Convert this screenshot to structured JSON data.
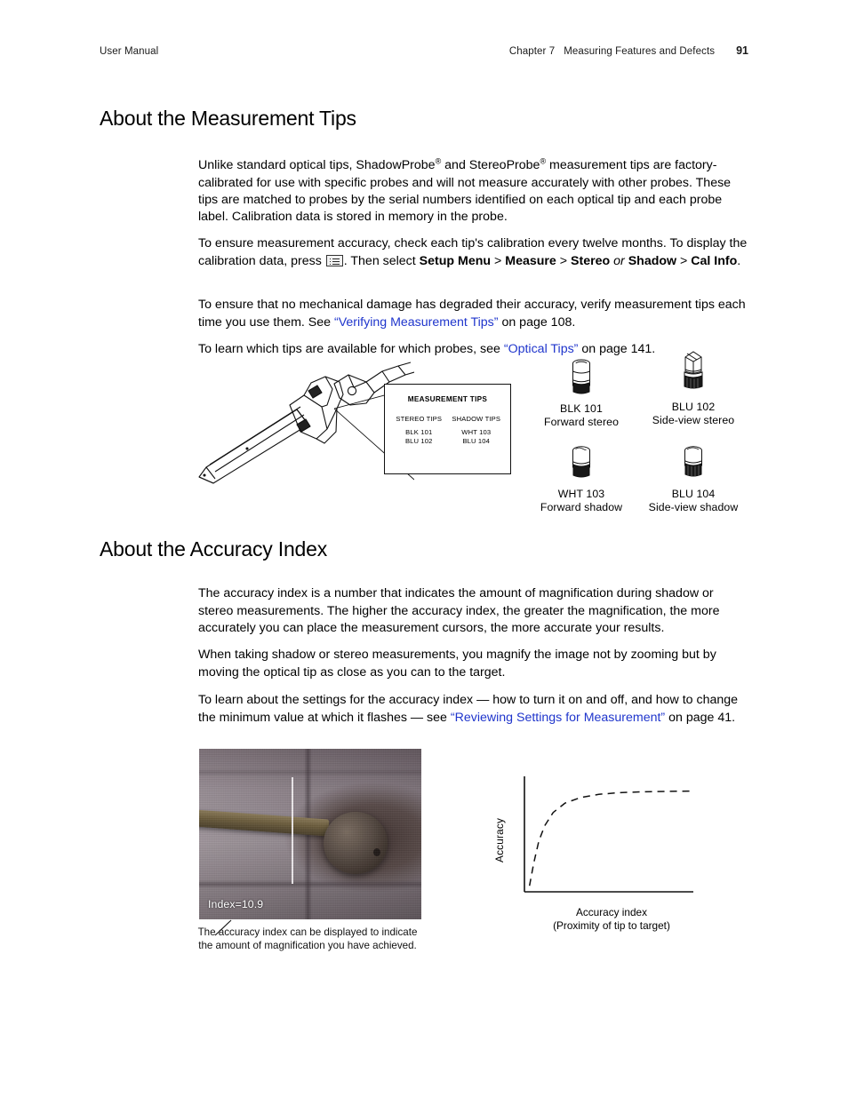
{
  "header": {
    "left": "User Manual",
    "chapter": "Chapter 7",
    "title": "Measuring Features and Defects",
    "page": "91"
  },
  "sections": {
    "tips": {
      "heading": "About the Measurement Tips",
      "p1_a": "Unlike standard optical tips, ShadowProbe",
      "p1_sup1": "®",
      "p1_b": " and StereoProbe",
      "p1_sup2": "®",
      "p1_c": " measurement tips are factory-calibrated for use with specific probes and will not measure accurately with other probes. These tips are matched to probes by the serial numbers identified on each optical tip and each probe label. Calibration data is stored in memory in the probe.",
      "p2_a": "To ensure measurement accuracy, check each tip's calibration every twelve months. To display the calibration data, press ",
      "p2_icon": "menu-key-icon",
      "p2_b": ". Then select ",
      "p2_bold1": "Setup Menu",
      "p2_gt1": " > ",
      "p2_bold2": "Measure",
      "p2_gt2": " > ",
      "p2_bold3": "Stereo",
      "p2_or": "or",
      "p2_bold4": "Shadow",
      "p2_gt3": " > ",
      "p2_bold5": "Cal Info",
      "p2_end": ".",
      "p3_a": "To ensure that no mechanical damage has degraded their accuracy, verify measurement tips each time you use them. See ",
      "p3_link": "“Verifying Measurement Tips”",
      "p3_b": " on page 108.",
      "p4_a": "To learn which tips are available for which probes, see ",
      "p4_link": "“Optical Tips”",
      "p4_b": " on page 141."
    },
    "index": {
      "heading": "About the Accuracy Index",
      "p5": "The accuracy index is a number that indicates the amount of magnification during shadow or stereo measurements. The higher the accuracy index, the greater the magnification, the more accurately you can place the measurement cursors, the more accurate your results.",
      "p6": "When taking shadow or stereo measurements, you magnify the image not by zooming but by moving the optical tip as close as you can to the target.",
      "p7_a": "To learn about the settings for the accuracy index — how to turn it on and off, and how to change the minimum value at which it flashes — see ",
      "p7_link": "“Reviewing Settings for Measurement”",
      "p7_b": " on page 41."
    }
  },
  "figure_tips": {
    "callout": {
      "title": "MEASUREMENT TIPS",
      "columns": [
        {
          "header": "STEREO TIPS",
          "items": "BLK 101\nBLU 102"
        },
        {
          "header": "SHADOW TIPS",
          "items": "WHT 103\nBLU 104"
        }
      ],
      "col0_header": "STEREO TIPS",
      "col0_l1": "BLK 101",
      "col0_l2": "BLU 102",
      "col1_header": "SHADOW TIPS",
      "col1_l1": "WHT 103",
      "col1_l2": "BLU 104"
    },
    "tips": [
      {
        "name": "BLK 101",
        "desc": "Forward stereo",
        "icon": "forward-tip-icon"
      },
      {
        "name": "BLU 102",
        "desc": "Side-view stereo",
        "icon": "side-view-tip-icon"
      },
      {
        "name": "WHT 103",
        "desc": "Forward shadow",
        "icon": "forward-tip-icon"
      },
      {
        "name": "BLU 104",
        "desc": "Side-view shadow",
        "icon": "side-view-tip-icon"
      }
    ]
  },
  "figure_photo": {
    "index_label": "Index=10.9",
    "caption_l1": "The accuracy index can be displayed to indicate",
    "caption_l2": "the amount of magnification you have achieved."
  },
  "chart_data": {
    "type": "line",
    "title": "",
    "xlabel": "Accuracy index",
    "xlabel_sub": "(Proximity of tip to target)",
    "ylabel": "Accuracy",
    "grid": false,
    "legend": null,
    "xlim": [
      0,
      10
    ],
    "ylim": [
      0,
      10
    ],
    "axis_ticks": false,
    "line_style": "dashed",
    "x": [
      0.3,
      0.55,
      0.85,
      1.2,
      1.7,
      2.4,
      3.3,
      4.4,
      5.6,
      7.0,
      8.4,
      10.0
    ],
    "y": [
      0.55,
      2.6,
      4.6,
      6.0,
      7.2,
      8.05,
      8.55,
      8.85,
      9.0,
      9.08,
      9.12,
      9.15
    ]
  }
}
